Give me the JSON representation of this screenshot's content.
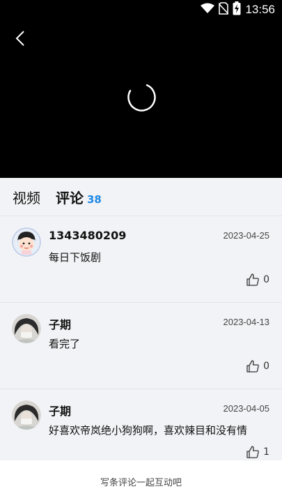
{
  "status_bar": {
    "time": "13:56",
    "icons": [
      "wifi-icon",
      "no-sim-icon",
      "battery-charging-icon"
    ]
  },
  "player": {
    "back_icon": "back-arrow-icon",
    "loading_icon": "loading-spinner-icon"
  },
  "tabs": [
    {
      "label": "视频"
    },
    {
      "label": "评论",
      "count": "38"
    }
  ],
  "colors": {
    "accent": "#1e88e5",
    "video_bg": "#000000",
    "page_bg": "#f2f3f6"
  },
  "comments": [
    {
      "username": "1343480209",
      "date": "2023-04-25",
      "text": "每日下饭剧",
      "likes": "0",
      "avatar": "cartoon-girl-avatar"
    },
    {
      "username": "子期",
      "date": "2023-04-13",
      "text": "看完了",
      "likes": "0",
      "avatar": "photo-avatar"
    },
    {
      "username": "子期",
      "date": "2023-04-05",
      "text": "好喜欢帝岚绝小狗狗啊，喜欢辣目和没有情",
      "likes": "1",
      "avatar": "photo-avatar"
    }
  ],
  "footer": {
    "placeholder": "写条评论一起互动吧"
  }
}
